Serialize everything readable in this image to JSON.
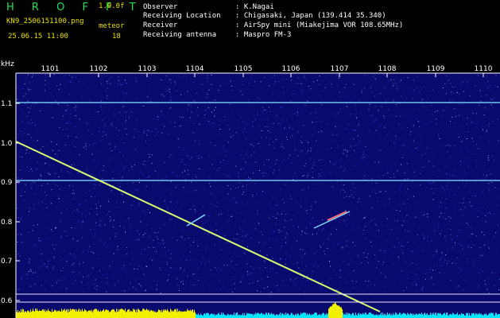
{
  "header": {
    "brand": "H R O F F T",
    "version": "1.0.0f",
    "filename": "KN9_2506151100.png",
    "datetime": "25.06.15 11:00",
    "mode_label": "meteor",
    "count": "18",
    "info": [
      {
        "label": "Observer",
        "value": ": K.Nagai"
      },
      {
        "label": "Receiving Location",
        "value": ": Chigasaki, Japan (139.414 35.340)"
      },
      {
        "label": "Receiver",
        "value": ": AirSpy mini (Miakejima VOR 108.65MHz)"
      },
      {
        "label": "Receiving antenna",
        "value": ": Maspro FM-3"
      }
    ]
  },
  "plot": {
    "y_unit": "kHz",
    "x_ticks": [
      "1101",
      "1102",
      "1103",
      "1104",
      "1105",
      "1106",
      "1107",
      "1108",
      "1109",
      "1110"
    ],
    "y_ticks": [
      "1.1",
      "1.0",
      "0.9",
      "0.8",
      "0.7",
      "0.6"
    ],
    "colors": {
      "background": "#0a0a6e",
      "trace": "#d8ff70",
      "signal": "#7fd8ff",
      "level_yellow": "#f0f000",
      "level_cyan": "#00e8ff",
      "axis": "#ffffff"
    }
  }
}
